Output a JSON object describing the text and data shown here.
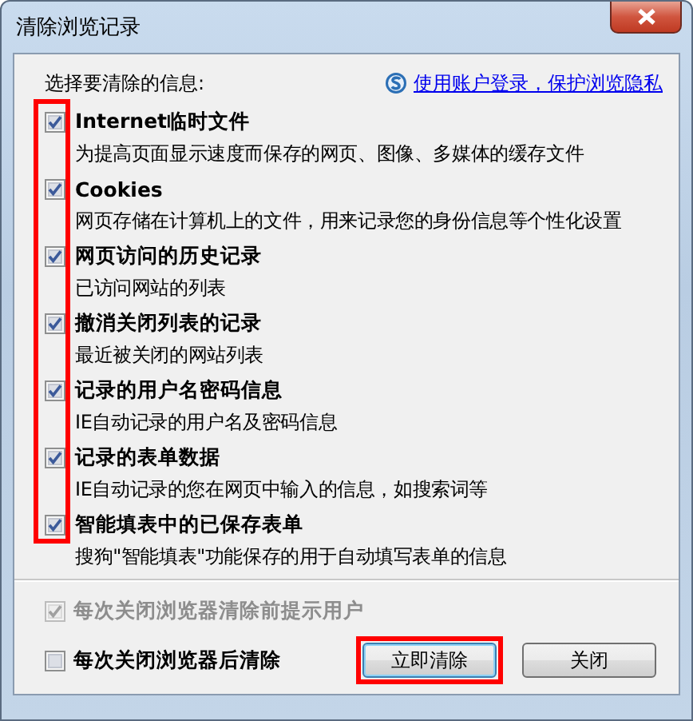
{
  "window": {
    "title": "清除浏览记录"
  },
  "section_label": "选择要清除的信息:",
  "account_link": "使用账户登录，保护浏览隐私",
  "checkbox_column_highlight": true,
  "options": [
    {
      "title": "Internet临时文件",
      "description": "为提高页面显示速度而保存的网页、图像、多媒体的缓存文件",
      "checked": true
    },
    {
      "title": "Cookies",
      "description": "网页存储在计算机上的文件，用来记录您的身份信息等个性化设置",
      "checked": true
    },
    {
      "title": "网页访问的历史记录",
      "description": "已访问网站的列表",
      "checked": true
    },
    {
      "title": "撤消关闭列表的记录",
      "description": "最近被关闭的网站列表",
      "checked": true
    },
    {
      "title": "记录的用户名密码信息",
      "description": "IE自动记录的用户名及密码信息",
      "checked": true
    },
    {
      "title": "记录的表单数据",
      "description": "IE自动记录的您在网页中输入的信息，如搜索词等",
      "checked": true
    },
    {
      "title": "智能填表中的已保存表单",
      "description": "搜狗\"智能填表\"功能保存的用于自动填写表单的信息",
      "checked": true
    }
  ],
  "footer_options": [
    {
      "label": "每次关闭浏览器清除前提示用户",
      "checked": true,
      "disabled": true
    },
    {
      "label": "每次关闭浏览器后清除",
      "checked": false,
      "disabled": false
    }
  ],
  "buttons": [
    {
      "label": "立即清除",
      "highlight": true
    },
    {
      "label": "关闭",
      "highlight": false
    }
  ]
}
